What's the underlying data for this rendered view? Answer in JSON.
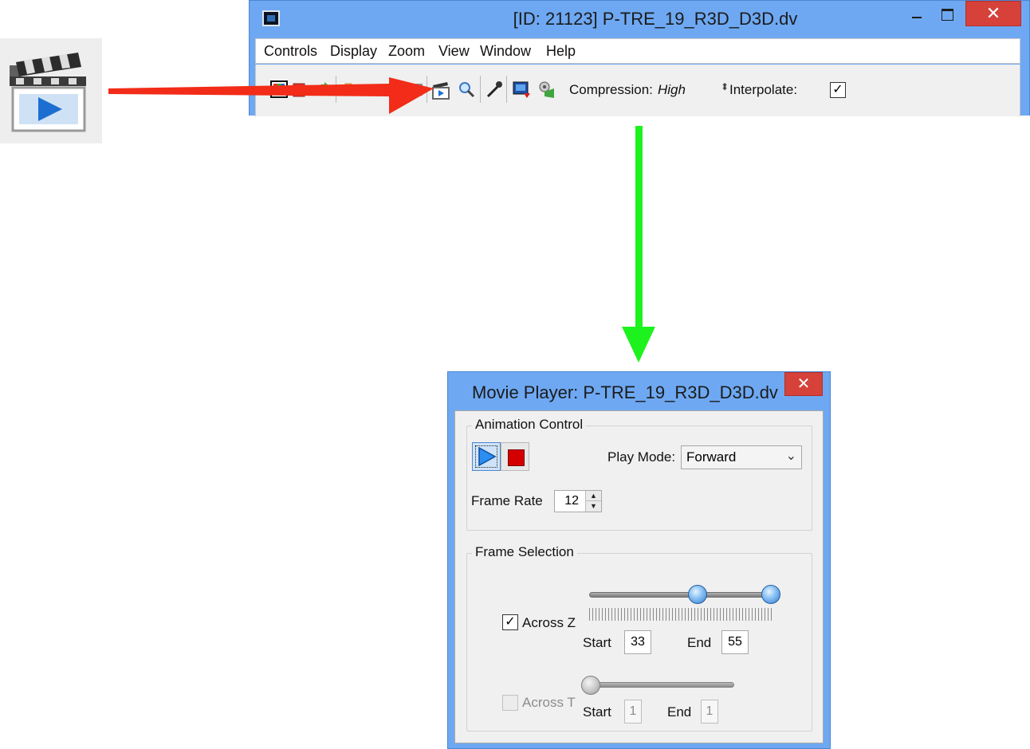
{
  "main_window": {
    "title": "[ID: 21123] P-TRE_19_R3D_D3D.dv",
    "close_glyph": "✕",
    "menu": [
      "Controls",
      "Display",
      "Zoom",
      "View",
      "Window",
      "Help"
    ],
    "toolbar": {
      "compression_label": "Compression:",
      "compression_value": "High",
      "spinner_glyph": "⬍",
      "interpolate_label": "Interpolate:",
      "interpolate_checked": "✓"
    }
  },
  "movie_player": {
    "title": "Movie Player: P-TRE_19_R3D_D3D.dv",
    "close_glyph": "✕",
    "animation_control": {
      "group_label": "Animation Control",
      "play_mode_label": "Play Mode:",
      "play_mode_value": "Forward",
      "chevron": "⌄",
      "frame_rate_label": "Frame Rate",
      "frame_rate_value": "12",
      "spin_up": "▲",
      "spin_down": "▼"
    },
    "frame_selection": {
      "group_label": "Frame Selection",
      "across_z": {
        "label": "Across Z",
        "checked_glyph": "✓",
        "start_label": "Start",
        "start_value": "33",
        "end_label": "End",
        "end_value": "55"
      },
      "across_t": {
        "label": "Across T",
        "start_label": "Start",
        "start_value": "1",
        "end_label": "End",
        "end_value": "1"
      }
    }
  },
  "annotations": {
    "red_arrow_color": "#f22c18",
    "green_arrow_color": "#1ef21e"
  },
  "icons": [
    "movie-clapper-icon",
    "palette-icon",
    "export-icon",
    "refresh-icon",
    "folder-icon",
    "film-icon",
    "magnifier-icon",
    "eyedropper-icon",
    "save-image-icon",
    "record-icon",
    "play-icon",
    "stop-icon"
  ]
}
